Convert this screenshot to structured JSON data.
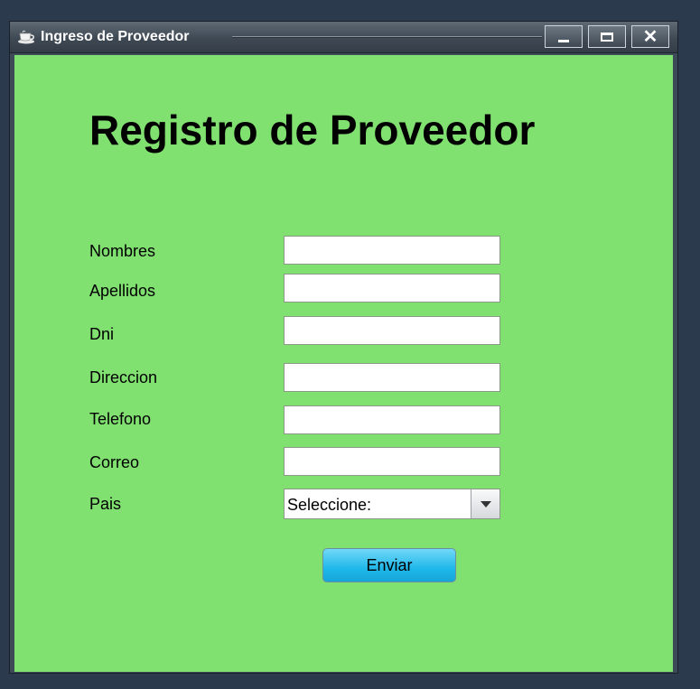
{
  "window": {
    "title": "Ingreso de Proveedor"
  },
  "form": {
    "heading": "Registro de Proveedor",
    "fields": [
      {
        "label": "Nombres",
        "value": ""
      },
      {
        "label": "Apellidos",
        "value": ""
      },
      {
        "label": "Dni",
        "value": ""
      },
      {
        "label": "Direccion",
        "value": ""
      },
      {
        "label": "Telefono",
        "value": ""
      },
      {
        "label": "Correo",
        "value": ""
      }
    ],
    "country": {
      "label": "Pais",
      "selected": "Seleccione:"
    },
    "submit_label": "Enviar"
  },
  "colors": {
    "background": "#80e070",
    "button": "#1fb8ea",
    "titlebar": "#3f4954"
  },
  "icons": {
    "app": "coffee-cup-icon",
    "minimize": "minimize-icon",
    "maximize": "maximize-icon",
    "close": "close-icon",
    "dropdown": "chevron-down-icon"
  }
}
